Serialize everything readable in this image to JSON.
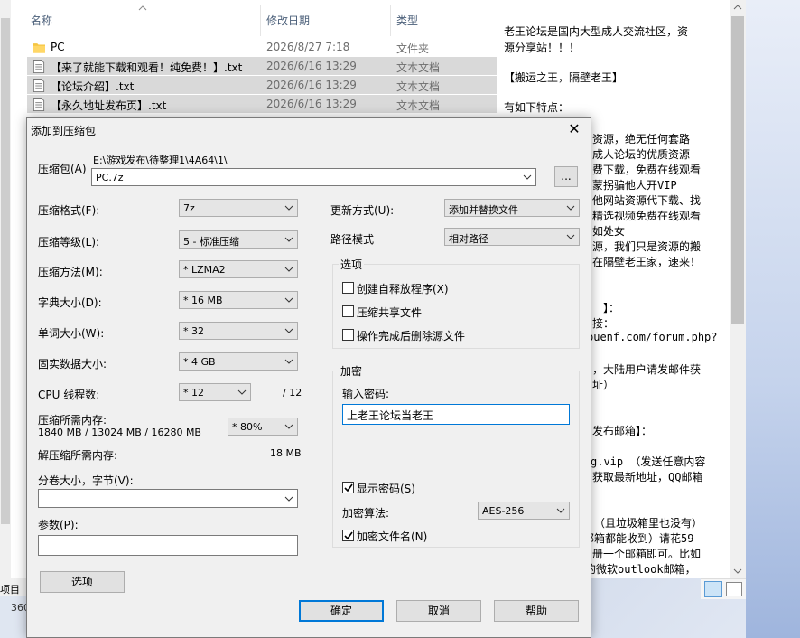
{
  "explorer": {
    "col_name": "名称",
    "col_date": "修改日期",
    "col_type": "类型",
    "rows": [
      {
        "name": "PC",
        "date": "2026/8/27 7:18",
        "type": "文件夹"
      },
      {
        "name": "【来了就能下载和观看！纯免费！】.txt",
        "date": "2026/6/16 13:29",
        "type": "文本文档"
      },
      {
        "name": "【论坛介绍】.txt",
        "date": "2026/6/16 13:29",
        "type": "文本文档"
      },
      {
        "name": "【永久地址发布页】.txt",
        "date": "2026/6/16 13:29",
        "type": "文本文档"
      }
    ],
    "status_left": "项目",
    "status_360": "360"
  },
  "viewer": {
    "lines": [
      "老王论坛是国内大型成人交流社区，资",
      "源分享站！！！",
      "【搬运之王，隔壁老王】",
      "有如下特点：",
      "资源，绝无任何套路",
      "成人论坛的优质资源",
      "费下载，免费在线观看",
      "蒙拐骗他人开VIP",
      "他网站资源代下载、找",
      "精选视频免费在线观看",
      "如处女",
      "源，我们只是资源的搬",
      "在隔壁老王家，速来！",
      "】：",
      "接：",
      "puenf.com/forum.php?",
      "，大陆用户请发邮件获",
      "址）",
      "发布邮箱】：",
      "g.vip  （发送任意内容",
      "获取最新地址，QQ邮箱",
      "（且垃圾箱里也没有）",
      "邮箱都能收到）请花59",
      "册一个邮箱即可。比如",
      "的微软outlook邮箱，"
    ]
  },
  "dialog": {
    "title": "添加到压缩包",
    "archive_label": "压缩包(A)",
    "archive_path": "E:\\游戏发布\\待整理1\\4A64\\1\\",
    "archive_name": "PC.7z",
    "browse_label": "...",
    "format_label": "压缩格式(F):",
    "format_value": "7z",
    "level_label": "压缩等级(L):",
    "level_value": "5 - 标准压缩",
    "method_label": "压缩方法(M):",
    "method_value": "* LZMA2",
    "dict_label": "字典大小(D):",
    "dict_value": "* 16 MB",
    "word_label": "单词大小(W):",
    "word_value": "* 32",
    "solid_label": "固实数据大小:",
    "solid_value": "* 4 GB",
    "threads_label": "CPU 线程数:",
    "threads_value": "* 12",
    "threads_max": "/ 12",
    "mem_label": "压缩所需内存:",
    "mem_detail": "1840 MB / 13024 MB / 16280 MB",
    "mem_percent": "* 80%",
    "decomp_label": "解压缩所需内存:",
    "decomp_value": "18 MB",
    "split_label": "分卷大小，字节(V):",
    "split_value": "",
    "params_label": "参数(P):",
    "params_value": "",
    "options_button": "选项",
    "update_label": "更新方式(U):",
    "update_value": "添加并替换文件",
    "path_label": "路径模式",
    "path_value": "相对路径",
    "options_group": "选项",
    "opt_sfx": "创建自释放程序(X)",
    "opt_shared": "压缩共享文件",
    "opt_delete": "操作完成后删除源文件",
    "encrypt_group": "加密",
    "password_label": "输入密码:",
    "password_value": "上老王论坛当老王",
    "show_password": "显示密码(S)",
    "enc_method_label": "加密算法:",
    "enc_method_value": "AES-256",
    "encrypt_names": "加密文件名(N)",
    "ok_button": "确定",
    "cancel_button": "取消",
    "help_button": "帮助"
  }
}
